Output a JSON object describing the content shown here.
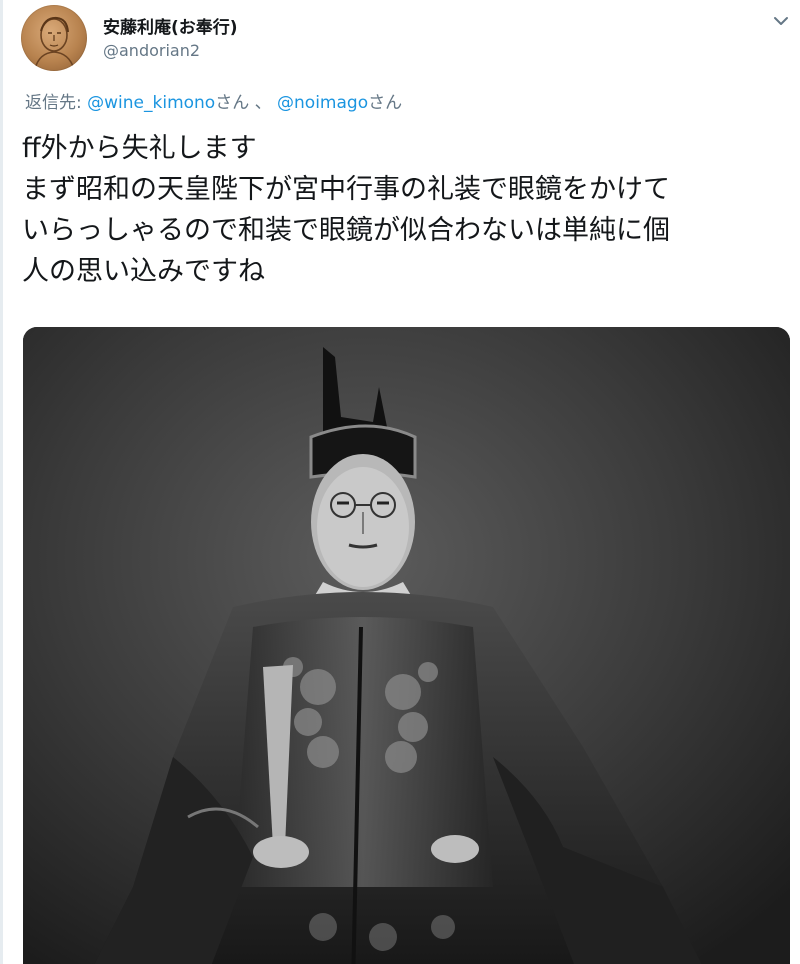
{
  "author": {
    "display_name": "安藤利庵(お奉行)",
    "handle": "@andorian2",
    "avatar_icon": "profile-portrait-icon"
  },
  "menu": {
    "icon": "chevron-down-icon"
  },
  "reply": {
    "prefix": "返信先: ",
    "mention_1": "@wine_kimono",
    "suffix_1": "さん 、 ",
    "mention_2": "@noimago",
    "suffix_2": "さん"
  },
  "tweet": {
    "lines": [
      "ff外から失礼します",
      "まず昭和の天皇陛下が宮中行事の礼装で眼鏡をかけて",
      "いらっしゃるので和装で眼鏡が似合わないは単純に個",
      "人の思い込みですね"
    ]
  },
  "colors": {
    "link": "#1b95e0",
    "secondary_text": "#657786",
    "primary_text": "#14171a"
  }
}
